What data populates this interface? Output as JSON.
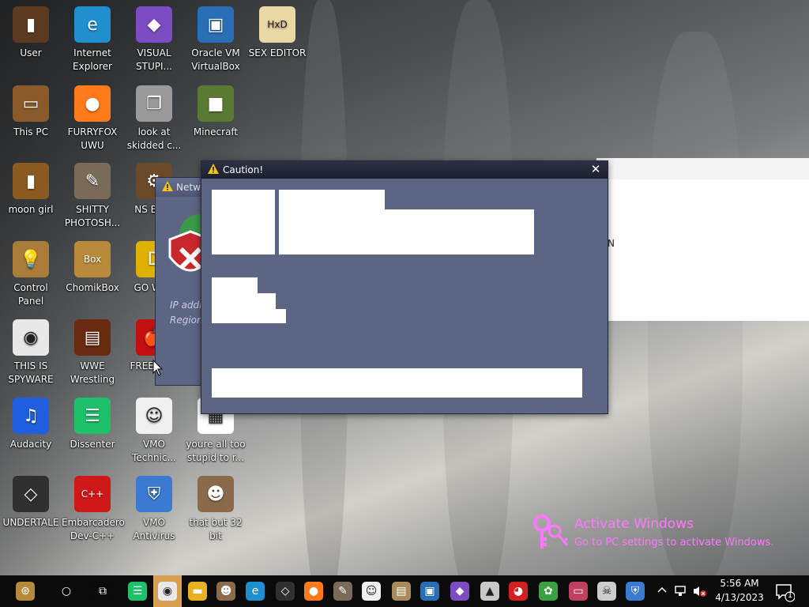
{
  "desktop": {
    "icons": [
      {
        "label": "User",
        "icon": "user-folder-icon",
        "color": "#5b3a20",
        "glyph": "▮"
      },
      {
        "label": "Internet Explorer",
        "icon": "edge-icon",
        "color": "#1f8fd0",
        "glyph": "e"
      },
      {
        "label": "VISUAL STUPI...",
        "icon": "visual-studio-icon",
        "color": "#7b4cc2",
        "glyph": "◆"
      },
      {
        "label": "Oracle VM VirtualBox",
        "icon": "virtualbox-icon",
        "color": "#2a6fb5",
        "glyph": "▣"
      },
      {
        "label": "SEX EDITOR",
        "icon": "hxd-editor-icon",
        "color": "#e9d7a4",
        "glyph": "HxD"
      },
      {
        "label": "This PC",
        "icon": "computer-icon",
        "color": "#8a5a2a",
        "glyph": "▭"
      },
      {
        "label": "FURRYFOX UWU",
        "icon": "firefox-icon",
        "color": "#ff7a1a",
        "glyph": "●"
      },
      {
        "label": "look at skidded c...",
        "icon": "shortcut-stack-icon",
        "color": "#9a9a9a",
        "glyph": "❐"
      },
      {
        "label": "Minecraft",
        "icon": "minecraft-icon",
        "color": "#5a7a34",
        "glyph": "■"
      },
      {
        "label": "moon girl",
        "icon": "folder-icon",
        "color": "#8a5a20",
        "glyph": "▮"
      },
      {
        "label": "SHITTY PHOTOSH...",
        "icon": "gimp-icon",
        "color": "#7a6a58",
        "glyph": "✎"
      },
      {
        "label": "NS Back",
        "icon": "nsfw-back-icon",
        "color": "#6a4a2a",
        "glyph": "⚙"
      },
      {
        "label": "Control Panel",
        "icon": "control-panel-icon",
        "color": "#a97c3a",
        "glyph": "💡"
      },
      {
        "label": "ChomikBox",
        "icon": "chomikbox-icon",
        "color": "#b88a3a",
        "glyph": "Box"
      },
      {
        "label": "GO WHE",
        "icon": "go-app-icon",
        "color": "#e0b000",
        "glyph": "D"
      },
      {
        "label": "THIS IS SPYWARE",
        "icon": "chrome-icon",
        "color": "#e8e8e8",
        "glyph": "◉"
      },
      {
        "label": "WWE Wrestling",
        "icon": "wwe-icon",
        "color": "#6a2a10",
        "glyph": "▤"
      },
      {
        "label": "FREE GIFT",
        "icon": "apple-gift-icon",
        "color": "#c21010",
        "glyph": "🍎"
      },
      {
        "label": "Audacity",
        "icon": "audacity-icon",
        "color": "#1f5fe0",
        "glyph": "♫"
      },
      {
        "label": "Dissenter",
        "icon": "dissenter-icon",
        "color": "#1ec06a",
        "glyph": "☰"
      },
      {
        "label": "VMO Technic...",
        "icon": "technician-icon",
        "color": "#f0f0f0",
        "glyph": "☺"
      },
      {
        "label": "youre all too stupid to r...",
        "icon": "image-file-icon",
        "color": "#ffffff",
        "glyph": "▦"
      },
      {
        "label": "UNDERTALE",
        "icon": "unity-icon",
        "color": "#303030",
        "glyph": "◇"
      },
      {
        "label": "Embarcadero Dev-C++",
        "icon": "devcpp-icon",
        "color": "#d01818",
        "glyph": "C++"
      },
      {
        "label": "VMO Antivirus",
        "icon": "shield-icon",
        "color": "#3a7ad0",
        "glyph": "⛨"
      },
      {
        "label": "that but 32 bit",
        "icon": "portrait-icon",
        "color": "#8a6a4a",
        "glyph": "☻"
      }
    ]
  },
  "background_window": {
    "fragment": "N"
  },
  "network_window": {
    "title": "Netw",
    "ip_label": "IP addr",
    "region_label": "Region"
  },
  "caution_dialog": {
    "title": "Caution!",
    "close_glyph": "✕",
    "warning_icon": "warning-icon"
  },
  "activate": {
    "title": "Activate Windows",
    "subtitle": "Go to PC settings to activate Windows."
  },
  "taskbar": {
    "time": "5:56 AM",
    "date": "4/13/2023",
    "notifications": "1",
    "items": [
      {
        "name": "start-button-icon",
        "color": "#b58a3a",
        "glyph": "⊛"
      },
      {
        "name": "cortana-icon",
        "color": "#0a0a0a",
        "glyph": "○"
      },
      {
        "name": "task-view-icon",
        "color": "#0a0a0a",
        "glyph": "⧉"
      },
      {
        "name": "dissenter-taskbar-icon",
        "color": "#1ec06a",
        "glyph": "☰"
      },
      {
        "name": "chrome-taskbar-icon",
        "color": "#e8e8e8",
        "glyph": "◉"
      },
      {
        "name": "file-explorer-icon",
        "color": "#e8b020",
        "glyph": "▬"
      },
      {
        "name": "portrait-taskbar-icon",
        "color": "#8a6a4a",
        "glyph": "☻"
      },
      {
        "name": "edge-taskbar-icon",
        "color": "#1f8fd0",
        "glyph": "e"
      },
      {
        "name": "unity-taskbar-icon",
        "color": "#303030",
        "glyph": "◇"
      },
      {
        "name": "firefox-taskbar-icon",
        "color": "#ff7a1a",
        "glyph": "●"
      },
      {
        "name": "gimp-taskbar-icon",
        "color": "#7a6a58",
        "glyph": "✎"
      },
      {
        "name": "technician-taskbar-icon",
        "color": "#f0f0f0",
        "glyph": "☺"
      },
      {
        "name": "ruler-app-icon",
        "color": "#a98a5a",
        "glyph": "▤"
      },
      {
        "name": "virtualbox-taskbar-icon",
        "color": "#2a6fb5",
        "glyph": "▣"
      },
      {
        "name": "visual-studio-taskbar-icon",
        "color": "#7b4cc2",
        "glyph": "◆"
      },
      {
        "name": "installer-icon",
        "color": "#c8c8c8",
        "glyph": "▲"
      },
      {
        "name": "red-app-icon",
        "color": "#d02020",
        "glyph": "◕"
      },
      {
        "name": "green-globe-icon",
        "color": "#3aa040",
        "glyph": "✿"
      },
      {
        "name": "monitor-app-icon",
        "color": "#c04060",
        "glyph": "▭"
      },
      {
        "name": "skull-app-icon",
        "color": "#cccccc",
        "glyph": "☠"
      },
      {
        "name": "shield-taskbar-icon",
        "color": "#3a7ad0",
        "glyph": "⛨"
      }
    ]
  }
}
